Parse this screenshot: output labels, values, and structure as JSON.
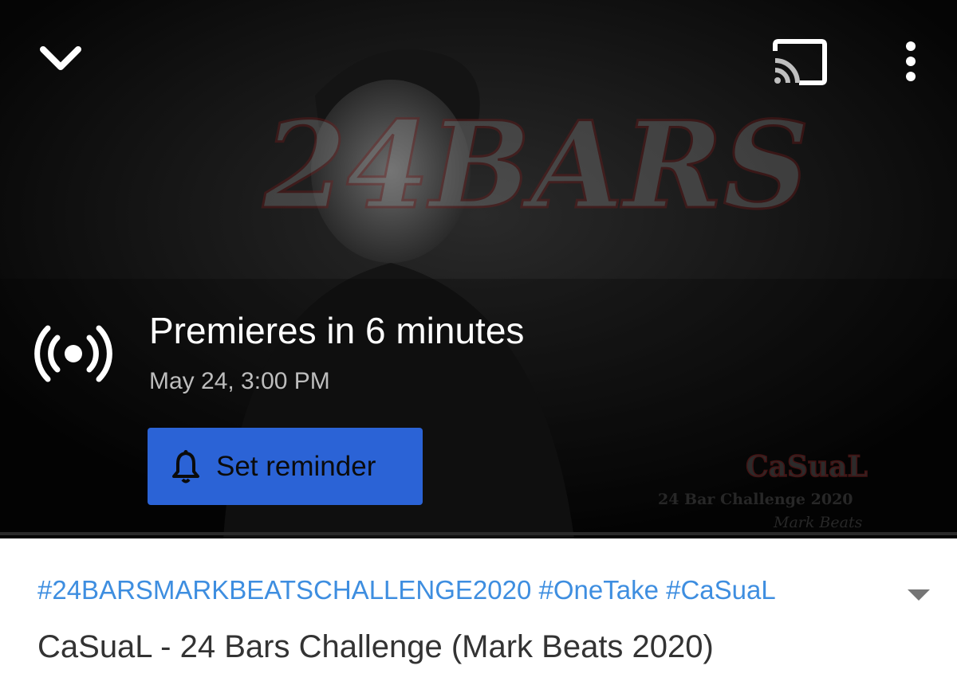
{
  "player": {
    "thumbnail": {
      "art_title": "24BARS",
      "artist": "CaSuaL",
      "subtitle": "24 Bar Challenge 2020",
      "producer": "Mark Beats"
    },
    "premiere": {
      "title": "Premieres in 6 minutes",
      "date": "May 24, 3:00 PM",
      "reminder_label": "Set reminder"
    },
    "icons": {
      "collapse": "chevron-down-icon",
      "cast": "cast-icon",
      "more": "more-vert-icon",
      "live": "live-broadcast-icon",
      "bell": "bell-icon"
    }
  },
  "video": {
    "hashtags": [
      "#24BARSMARKBEATSCHALLENGE2020",
      "#OneTake",
      "#CaSuaL"
    ],
    "title": "CaSuaL - 24 Bars Challenge (Mark Beats 2020)"
  },
  "colors": {
    "accent_blue": "#2b63d6",
    "hashtag_blue": "#3e8ee0"
  }
}
